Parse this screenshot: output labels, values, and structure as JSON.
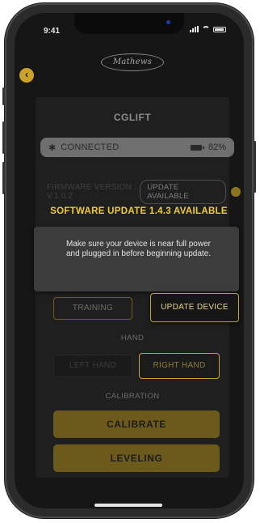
{
  "status_bar": {
    "time": "9:41"
  },
  "brand": {
    "logo_text": "Mathews"
  },
  "device": {
    "name": "CGLIFT",
    "connection_status": "CONNECTED",
    "battery_percent": "82%",
    "firmware_label": "FIRMWARE VERSION : V.1.0.2",
    "update_available_label": "UPDATE AVAILABLE"
  },
  "software_update": {
    "message": "SOFTWARE UPDATE 1.4.3 AVAILABLE"
  },
  "dialog": {
    "text": "Make sure your device is near full power and plugged in before beginning update."
  },
  "buttons": {
    "training": "TRAINING",
    "update_device": "UPDATE DEVICE",
    "left_hand": "LEFT HAND",
    "right_hand": "RIGHT HAND",
    "calibrate": "CALIBRATE",
    "leveling": "LEVELING"
  },
  "section_labels": {
    "hand": "HAND",
    "calibration": "CALIBRATION"
  },
  "colors": {
    "accent": "#c9a227",
    "highlight_text": "#f1cc33",
    "background": "#161616"
  }
}
